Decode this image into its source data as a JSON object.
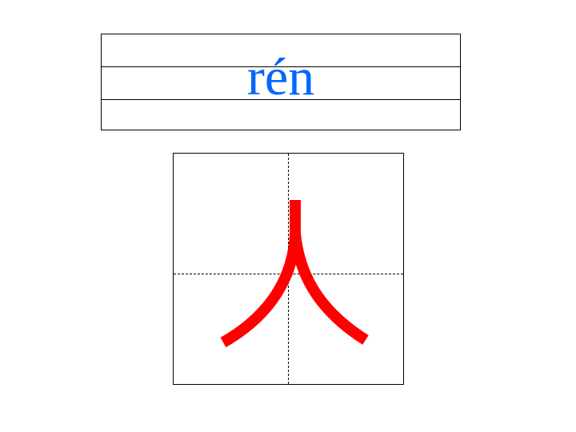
{
  "pinyin": {
    "text": "rén",
    "color": "#0066ff"
  },
  "character": {
    "glyph": "人",
    "stroke_color": "#ff0000",
    "grid": "tian-zi-ge"
  }
}
